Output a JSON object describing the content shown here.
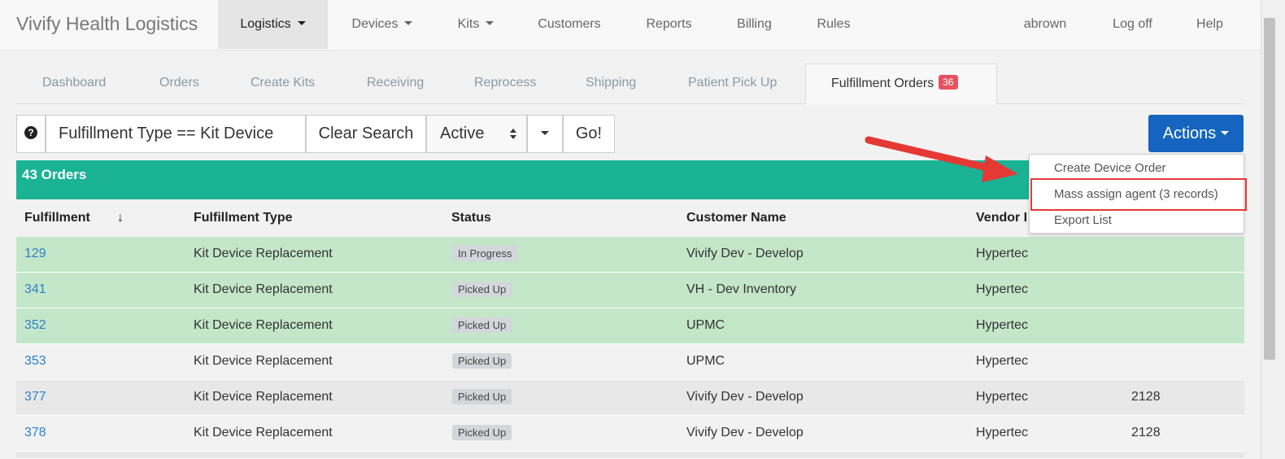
{
  "brand": "Vivify Health Logistics",
  "nav": {
    "items": [
      {
        "label": "Logistics",
        "active": true,
        "dropdown": true
      },
      {
        "label": "Devices",
        "dropdown": true
      },
      {
        "label": "Kits",
        "dropdown": true
      },
      {
        "label": "Customers"
      },
      {
        "label": "Reports"
      },
      {
        "label": "Billing"
      },
      {
        "label": "Rules"
      }
    ],
    "right": [
      "abrown",
      "Log off",
      "Help"
    ]
  },
  "tabs": [
    {
      "label": "Dashboard"
    },
    {
      "label": "Orders"
    },
    {
      "label": "Create Kits"
    },
    {
      "label": "Receiving"
    },
    {
      "label": "Reprocess"
    },
    {
      "label": "Shipping"
    },
    {
      "label": "Patient Pick Up"
    },
    {
      "label": "Fulfillment Orders",
      "badge": "36",
      "active": true
    }
  ],
  "search": {
    "help_icon": "?",
    "value": "Fulfillment Type == Kit Device",
    "clear_label": "Clear Search",
    "select_value": "Active",
    "go_label": "Go!"
  },
  "actions": {
    "label": "Actions",
    "menu": [
      "Create Device Order",
      "Mass assign agent (3 records)",
      "Export List"
    ]
  },
  "orders": {
    "title": "43 Orders",
    "columns": [
      "Fulfillment",
      "Fulfillment Type",
      "Status",
      "Customer Name",
      "Vendor I"
    ],
    "sort_indicator": "↓",
    "rows": [
      {
        "id": "129",
        "type": "Kit Device Replacement",
        "status": "In Progress",
        "customer": "Vivify Dev - Develop",
        "vendor": "Hypertec",
        "extra": ""
      },
      {
        "id": "341",
        "type": "Kit Device Replacement",
        "status": "Picked Up",
        "customer": "VH - Dev Inventory",
        "vendor": "Hypertec",
        "extra": ""
      },
      {
        "id": "352",
        "type": "Kit Device Replacement",
        "status": "Picked Up",
        "customer": "UPMC",
        "vendor": "Hypertec",
        "extra": ""
      },
      {
        "id": "353",
        "type": "Kit Device Replacement",
        "status": "Picked Up",
        "customer": "UPMC",
        "vendor": "Hypertec",
        "extra": ""
      },
      {
        "id": "377",
        "type": "Kit Device Replacement",
        "status": "Picked Up",
        "customer": "Vivify Dev - Develop",
        "vendor": "Hypertec",
        "extra": "2128"
      },
      {
        "id": "378",
        "type": "Kit Device Replacement",
        "status": "Picked Up",
        "customer": "Vivify Dev - Develop",
        "vendor": "Hypertec",
        "extra": "2128"
      }
    ]
  },
  "colors": {
    "accent": "#1565c0",
    "orders_bar": "#1ab394",
    "selected_row": "#c4e6c9",
    "badge": "#e8525f",
    "annotation": "#e53935"
  }
}
